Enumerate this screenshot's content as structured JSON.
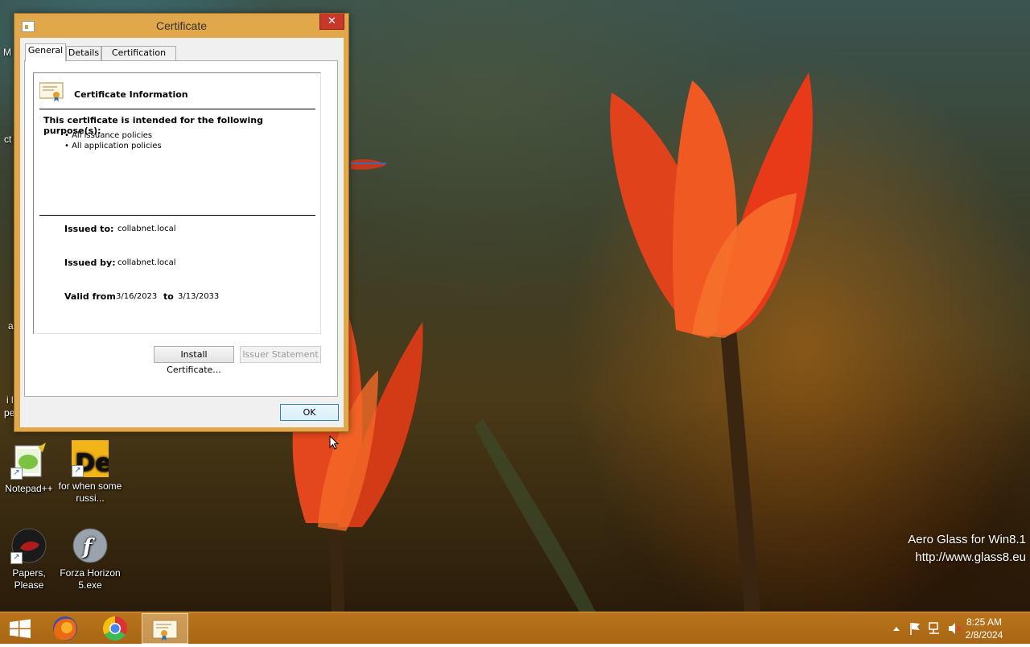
{
  "window": {
    "title": "Certificate",
    "close_glyph": "✕",
    "tabs": [
      {
        "label": "General",
        "active": true
      },
      {
        "label": "Details",
        "active": false
      },
      {
        "label": "Certification Path",
        "active": false
      }
    ],
    "info_heading": "Certificate Information",
    "purpose_heading": "This certificate is intended for the following purpose(s):",
    "purposes": [
      "All issuance policies",
      "All application policies"
    ],
    "issued_to_label": "Issued to:",
    "issued_to": "collabnet.local",
    "issued_by_label": "Issued by:",
    "issued_by": "collabnet.local",
    "valid_from_label": "Valid from",
    "valid_from": "3/16/2023",
    "valid_to_label": "to",
    "valid_to": "3/13/2033",
    "install_button": "Install Certificate...",
    "issuer_statement_button": "Issuer Statement",
    "ok_button": "OK"
  },
  "desktop": {
    "icons": [
      {
        "label": "Notepad++",
        "icon": "notepadpp-icon"
      },
      {
        "label": "for when some russi...",
        "icon": "de-icon"
      },
      {
        "label": "Papers, Please",
        "icon": "papers-please-icon"
      },
      {
        "label": "Forza Horizon 5.exe",
        "icon": "flash-icon"
      }
    ],
    "watermark_line1": "Aero Glass for Win8.1",
    "watermark_line2": "http://www.glass8.eu",
    "edge_fragments": [
      "M",
      "ct",
      "a",
      "i l",
      "pe"
    ]
  },
  "taskbar": {
    "apps": [
      {
        "name": "start",
        "icon": "windows-logo-icon"
      },
      {
        "name": "firefox",
        "icon": "firefox-icon"
      },
      {
        "name": "chrome",
        "icon": "chrome-icon"
      },
      {
        "name": "certificate",
        "icon": "certificate-icon",
        "active": true
      }
    ],
    "time": "8:25 AM",
    "date": "2/8/2024"
  },
  "colors": {
    "window_frame": "#e1a74b",
    "taskbar": "#b9741a",
    "close_button": "#c7382b"
  }
}
